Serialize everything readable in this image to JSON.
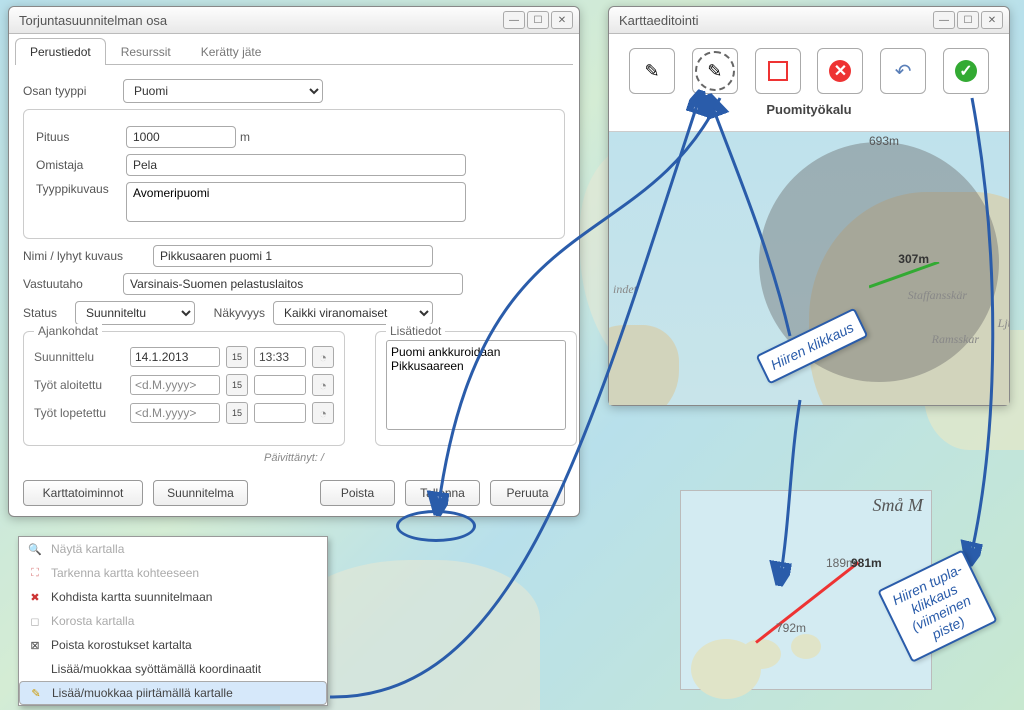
{
  "window1": {
    "title": "Torjuntasuunnitelman osa",
    "tabs": [
      "Perustiedot",
      "Resurssit",
      "Kerätty jäte"
    ],
    "active_tab": 0,
    "type_label": "Osan tyyppi",
    "type_value": "Puomi",
    "box1": {
      "length_label": "Pituus",
      "length_value": "1000",
      "length_unit": "m",
      "owner_label": "Omistaja",
      "owner_value": "Pela",
      "typedesc_label": "Tyyppikuvaus",
      "typedesc_value": "Avomeripuomi"
    },
    "name_label": "Nimi / lyhyt kuvaus",
    "name_value": "Pikkusaaren puomi 1",
    "resp_label": "Vastuutaho",
    "resp_value": "Varsinais-Suomen pelastuslaitos",
    "status_label": "Status",
    "status_value": "Suunniteltu",
    "vis_label": "Näkyvyys",
    "vis_value": "Kaikki viranomaiset",
    "times": {
      "legend": "Ajankohdat",
      "plan_label": "Suunnittelu",
      "plan_date": "14.1.2013",
      "plan_time": "13:33",
      "start_label": "Työt aloitettu",
      "start_date": "<d.M.yyyy>",
      "end_label": "Työt lopetettu",
      "end_date": "<d.M.yyyy>"
    },
    "info_legend": "Lisätiedot",
    "info_value": "Puomi ankkuroidaan Pikkusaareen",
    "updated": "Päivittänyt:  /",
    "buttons": {
      "maptools": "Karttatoiminnot",
      "plan": "Suunnitelma",
      "delete": "Poista",
      "save": "Tallenna",
      "cancel": "Peruuta"
    }
  },
  "dropdown": {
    "items": [
      {
        "icon": "🔍",
        "label": "Näytä kartalla",
        "disabled": true
      },
      {
        "icon": "⛶",
        "label": "Tarkenna kartta kohteeseen",
        "disabled": true,
        "iconColor": "#d88"
      },
      {
        "icon": "✖",
        "label": "Kohdista kartta suunnitelmaan",
        "iconColor": "#c33"
      },
      {
        "icon": "◻",
        "label": "Korosta kartalla",
        "disabled": true
      },
      {
        "icon": "⊠",
        "label": "Poista korostukset kartalta"
      },
      {
        "icon": " ",
        "label": "Lisää/muokkaa syöttämällä koordinaatit"
      },
      {
        "icon": "✎",
        "label": "Lisää/muokkaa piirtämällä kartalle",
        "selected": true,
        "iconColor": "#c90"
      }
    ]
  },
  "window2": {
    "title": "Karttaeditointi",
    "caption": "Puomityökalu",
    "tools": [
      "pen-line",
      "pen-circle",
      "rect",
      "delete",
      "undo",
      "confirm"
    ]
  },
  "mapmini": {
    "title": "Små M",
    "d1": "189m",
    "d2": "981m",
    "d3": "792m"
  },
  "map2": {
    "d1": "693m",
    "d2": "307m",
    "place1": "Staffansskär",
    "place2": "Ramsskar",
    "place3": "Ljusskär",
    "place4": "indet"
  },
  "callouts": {
    "c1": "Hiiren klikkaus",
    "c2": "Hiiren tupla-\nklikkaus\n(viimeinen\npiste)"
  }
}
